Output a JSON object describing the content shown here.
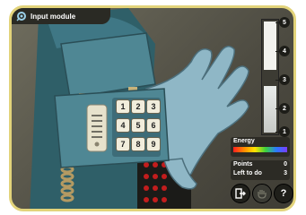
{
  "window": {
    "title": "Input module"
  },
  "meter": {
    "ticks": [
      "5",
      "4",
      "3",
      "2",
      "1"
    ],
    "level_fraction": 0.42
  },
  "energy": {
    "label": "Energy"
  },
  "stats": {
    "points_label": "Points",
    "points_value": "0",
    "left_label": "Left to do",
    "left_value": "3"
  },
  "keypad": {
    "keys": [
      "1",
      "2",
      "3",
      "4",
      "5",
      "6",
      "7",
      "8",
      "9"
    ]
  },
  "buttons": {
    "exit_icon": "exit-door-icon",
    "hand_icon": "hand-icon",
    "help_label": "?"
  },
  "colors": {
    "frame_border": "#e2d37a",
    "phone": "#4f8794",
    "glove": "#8fb7c6",
    "key": "#f1eddc"
  }
}
